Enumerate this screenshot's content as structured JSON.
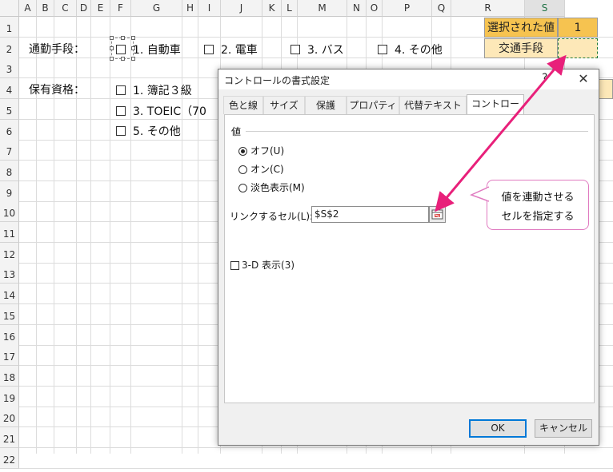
{
  "spreadsheet": {
    "columns": [
      "A",
      "B",
      "C",
      "D",
      "E",
      "F",
      "G",
      "H",
      "I",
      "J",
      "K",
      "L",
      "M",
      "N",
      "O",
      "P",
      "Q",
      "R",
      "S"
    ],
    "rows": [
      "1",
      "2",
      "3",
      "4",
      "5",
      "6",
      "7",
      "8",
      "9",
      "10",
      "11",
      "12",
      "13",
      "14",
      "15",
      "16",
      "17",
      "18",
      "19",
      "20",
      "21",
      "22"
    ],
    "label_commute": "通勤手段：",
    "commute_options": [
      "1. 自動車",
      "2. 電車",
      "3. バス",
      "4. その他"
    ],
    "label_qualifications": "保有資格：",
    "qualification_options": [
      "1. 簿記３級",
      "3. TOEIC（70",
      "5. その他"
    ],
    "header_selected_value": "選択された値",
    "selected_value": "1",
    "label_transport": "交通手段"
  },
  "dialog": {
    "title": "コントロールの書式設定",
    "help_glyph": "?",
    "close_glyph": "✕",
    "tabs": [
      "色と線",
      "サイズ",
      "保護",
      "プロパティ",
      "代替テキスト",
      "コントロール"
    ],
    "value_group": "値",
    "radio_off": "オフ(U)",
    "radio_on": "オン(C)",
    "radio_mixed": "淡色表示(M)",
    "link_label": "リンクするセル(L):",
    "link_value": "$S$2",
    "shade_3d": "3-D 表示(3)",
    "ok": "OK",
    "cancel": "キャンセル"
  },
  "callout": {
    "line1": "値を連動させる",
    "line2": "セルを指定する"
  },
  "colors": {
    "accent_orange": "#f6c350",
    "light_gold": "#fde8b8",
    "arrow": "#e8207a",
    "callout_border": "#e07ac0",
    "excel_green": "#217346"
  }
}
